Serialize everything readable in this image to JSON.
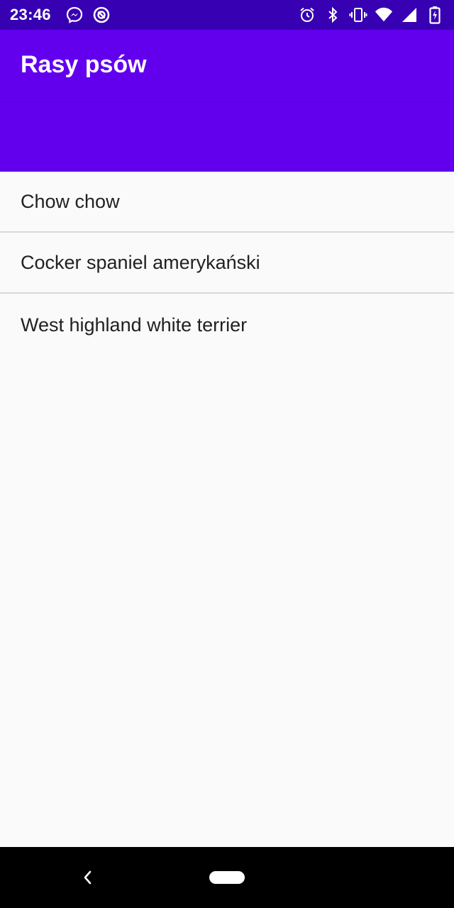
{
  "status_bar": {
    "time": "23:46",
    "left_icons": [
      "messenger-icon",
      "data-saver-icon"
    ],
    "right_icons": [
      "alarm-icon",
      "bluetooth-icon",
      "vibrate-icon",
      "wifi-icon",
      "signal-icon",
      "battery-charging-icon"
    ]
  },
  "app_bar": {
    "title": "Rasy psów",
    "color": "#6200ee",
    "status_color": "#3700b3"
  },
  "breeds": [
    "Chow chow",
    "Cocker spaniel amerykański",
    "West highland white terrier"
  ],
  "nav_bar": {
    "icons": [
      "back-icon",
      "home-pill-icon"
    ]
  }
}
